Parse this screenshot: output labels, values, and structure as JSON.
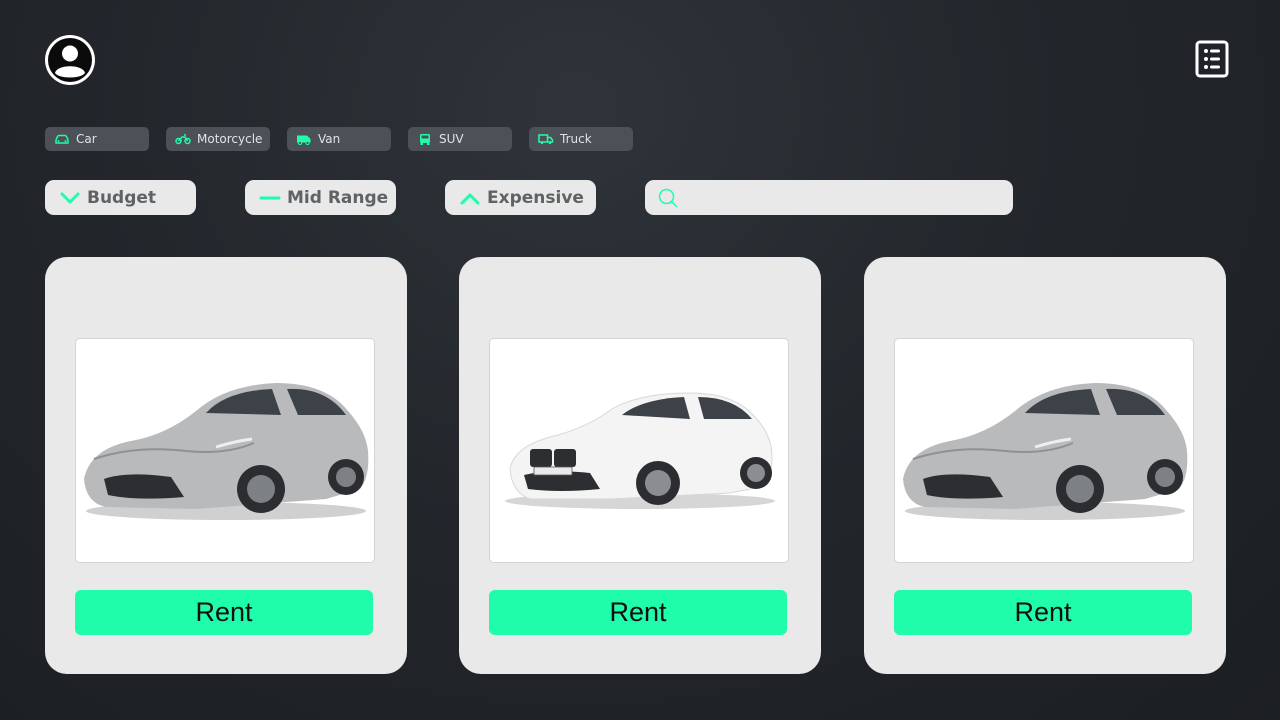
{
  "header": {
    "avatar_icon": "user-avatar-icon",
    "menu_icon": "list-icon"
  },
  "vehicle_types": [
    {
      "label": "Car",
      "icon": "car-icon"
    },
    {
      "label": "Motorcycle",
      "icon": "motorcycle-icon"
    },
    {
      "label": "Van",
      "icon": "van-icon"
    },
    {
      "label": "SUV",
      "icon": "suv-icon"
    },
    {
      "label": "Truck",
      "icon": "truck-icon"
    }
  ],
  "price_filters": [
    {
      "label": "Budget",
      "icon": "chevron-down-icon"
    },
    {
      "label": "Mid Range",
      "icon": "dash-icon"
    },
    {
      "label": "Expensive",
      "icon": "chevron-up-icon"
    }
  ],
  "search": {
    "placeholder": "",
    "value": "",
    "icon": "search-icon"
  },
  "cars": [
    {
      "image": "silver-sedan",
      "color": "#b9babc",
      "button_label": "Rent"
    },
    {
      "image": "white-sedan",
      "color": "#f4f4f4",
      "button_label": "Rent"
    },
    {
      "image": "silver-sedan",
      "color": "#b9babc",
      "button_label": "Rent"
    }
  ],
  "colors": {
    "accent": "#1ffdab",
    "chip_bg": "#4b5157",
    "panel_bg": "#e9e9e9",
    "background": "#23272c"
  }
}
